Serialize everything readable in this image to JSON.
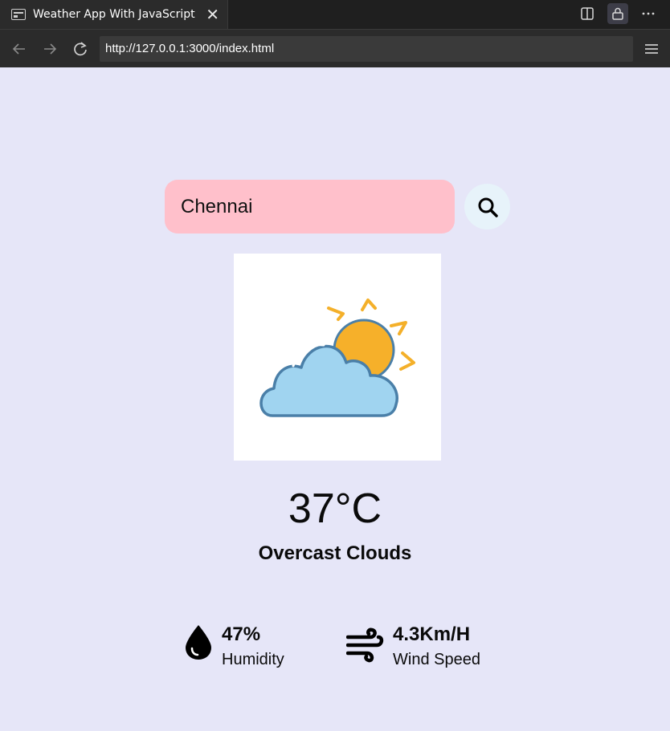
{
  "browser": {
    "tab_title": "Weather App With JavaScript",
    "url": "http://127.0.0.1:3000/index.html"
  },
  "search": {
    "value": "Chennai"
  },
  "weather": {
    "temperature": "37°C",
    "condition": "Overcast Clouds",
    "humidity_value": "47%",
    "humidity_label": "Humidity",
    "wind_value": "4.3Km/H",
    "wind_label": "Wind Speed"
  },
  "colors": {
    "page_bg": "#e6e6f8",
    "search_bg": "#ffc0cb",
    "search_button_bg": "#e7f3fa"
  }
}
